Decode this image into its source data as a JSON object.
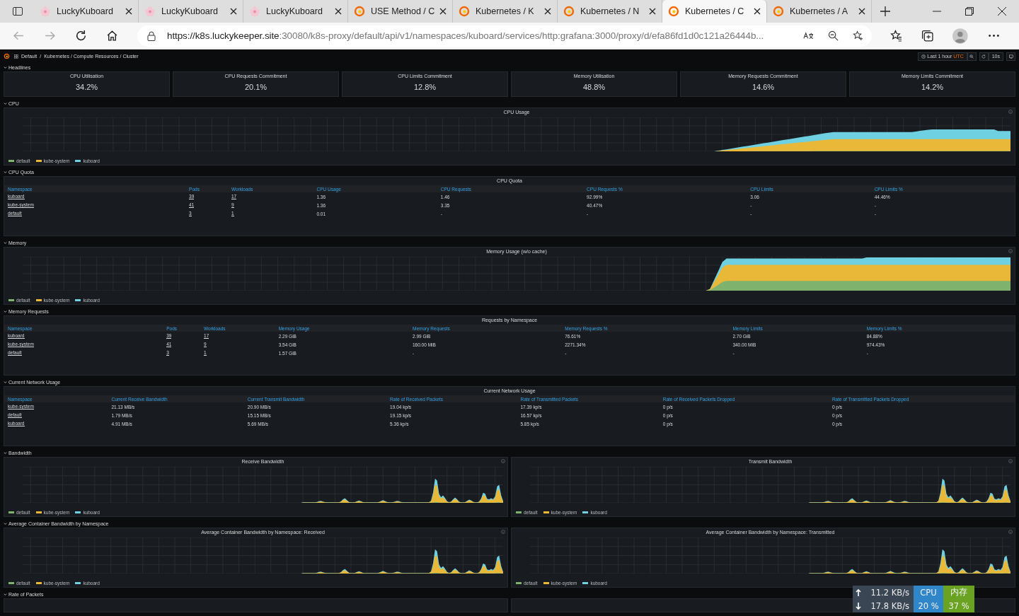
{
  "browser": {
    "tabs": [
      {
        "title": "LuckyKuboard",
        "selected": false
      },
      {
        "title": "LuckyKuboard",
        "selected": false
      },
      {
        "title": "LuckyKuboard",
        "selected": false
      },
      {
        "title": "USE Method / C",
        "selected": false
      },
      {
        "title": "Kubernetes / K",
        "selected": false
      },
      {
        "title": "Kubernetes / N",
        "selected": false
      },
      {
        "title": "Kubernetes / C",
        "selected": true
      },
      {
        "title": "Kubernetes / A",
        "selected": false
      }
    ],
    "url_host": "https://k8s.luckykeeper.site",
    "url_path": ":30080/k8s-proxy/default/api/v1/namespaces/kuboard/services/http:grafana:3000/proxy/d/efa86fd1d0c121a26444b..."
  },
  "dashboard": {
    "folder": "Default",
    "separator": "/",
    "title": "Kubernetes / Compute Resources / Cluster",
    "time_range": "Last 1 hour",
    "timezone": "UTC",
    "refresh": "10s"
  },
  "rows": [
    {
      "kind": "stats",
      "title": "Headlines",
      "stats": [
        {
          "label": "CPU Utilisation",
          "value": "34.2%"
        },
        {
          "label": "CPU Requests Commitment",
          "value": "20.1%"
        },
        {
          "label": "CPU Limits Commitment",
          "value": "12.8%"
        },
        {
          "label": "Memory Utilisation",
          "value": "48.8%"
        },
        {
          "label": "Memory Requests Commitment",
          "value": "14.6%"
        },
        {
          "label": "Memory Limits Commitment",
          "value": "14.2%"
        }
      ]
    },
    {
      "kind": "charts",
      "title": "CPU",
      "panels": [
        {
          "title": "CPU Usage",
          "legend": [
            {
              "name": "default",
              "color": "#7eb26d"
            },
            {
              "name": "kube-system",
              "color": "#eab839"
            },
            {
              "name": "kuboard",
              "color": "#6ed0e0"
            }
          ]
        }
      ]
    },
    {
      "kind": "table",
      "title": "CPU Quota",
      "panel_title": "CPU Quota",
      "columns": [
        {
          "name": "Namespace",
          "linked": true
        },
        {
          "name": "Pods",
          "linked": true
        },
        {
          "name": "Workloads",
          "linked": true
        },
        {
          "name": "CPU Usage",
          "linked": false
        },
        {
          "name": "CPU Requests",
          "linked": false
        },
        {
          "name": "CPU Requests %",
          "linked": false
        },
        {
          "name": "CPU Limits",
          "linked": false
        },
        {
          "name": "CPU Limits %",
          "linked": false
        }
      ],
      "rows": [
        [
          "kuboard",
          "39",
          "17",
          "1.36",
          "1.46",
          "92.99%",
          "3.06",
          "44.46%"
        ],
        [
          "kube-system",
          "41",
          "9",
          "1.36",
          "3.35",
          "40.47%",
          "-",
          "-"
        ],
        [
          "default",
          "3",
          "1",
          "0.01",
          "-",
          "-",
          "-",
          "-"
        ]
      ]
    },
    {
      "kind": "charts",
      "title": "Memory",
      "panels": [
        {
          "title": "Memory Usage (w/o cache)",
          "legend": [
            {
              "name": "default",
              "color": "#7eb26d"
            },
            {
              "name": "kube-system",
              "color": "#eab839"
            },
            {
              "name": "kuboard",
              "color": "#6ed0e0"
            }
          ]
        }
      ]
    },
    {
      "kind": "table",
      "title": "Memory Requests",
      "panel_title": "Requests by Namespace",
      "columns": [
        {
          "name": "Namespace",
          "linked": true
        },
        {
          "name": "Pods",
          "linked": true
        },
        {
          "name": "Workloads",
          "linked": true
        },
        {
          "name": "Memory Usage",
          "linked": false
        },
        {
          "name": "Memory Requests",
          "linked": false
        },
        {
          "name": "Memory Requests %",
          "linked": false
        },
        {
          "name": "Memory Limits",
          "linked": false
        },
        {
          "name": "Memory Limits %",
          "linked": false
        }
      ],
      "rows": [
        [
          "kuboard",
          "39",
          "17",
          "2.29 GiB",
          "2.99 GiB",
          "76.61%",
          "2.70 GiB",
          "84.88%"
        ],
        [
          "kube-system",
          "41",
          "9",
          "3.54 GiB",
          "160.00 MiB",
          "2271.34%",
          "340.00 MiB",
          "974.43%"
        ],
        [
          "default",
          "3",
          "1",
          "1.57 GiB",
          "-",
          "-",
          "-",
          "-"
        ]
      ]
    },
    {
      "kind": "table",
      "title": "Current Network Usage",
      "panel_title": "Current Network Usage",
      "columns": [
        {
          "name": "Namespace",
          "linked": true
        },
        {
          "name": "Current Receive Bandwidth",
          "linked": false
        },
        {
          "name": "Current Transmit Bandwidth",
          "linked": false
        },
        {
          "name": "Rate of Received Packets",
          "linked": false
        },
        {
          "name": "Rate of Transmitted Packets",
          "linked": false
        },
        {
          "name": "Rate of Received Packets Dropped",
          "linked": false
        },
        {
          "name": "Rate of Transmitted Packets Dropped",
          "linked": false
        }
      ],
      "rows": [
        [
          "kube-system",
          "21.13 MB/s",
          "20.90 MB/s",
          "19.04 kp/s",
          "17.39 kp/s",
          "0 p/s",
          "0 p/s"
        ],
        [
          "default",
          "1.79 MB/s",
          "15.15 MB/s",
          "19.15 kp/s",
          "16.57 kp/s",
          "0 p/s",
          "0 p/s"
        ],
        [
          "kuboard",
          "4.91 MB/s",
          "5.69 MB/s",
          "5.36 kp/s",
          "5.85 kp/s",
          "0 p/s",
          "0 p/s"
        ]
      ]
    },
    {
      "kind": "charts",
      "title": "Bandwidth",
      "panels": [
        {
          "title": "Receive Bandwidth",
          "legend": [
            {
              "name": "default",
              "color": "#7eb26d"
            },
            {
              "name": "kube-system",
              "color": "#eab839"
            },
            {
              "name": "kuboard",
              "color": "#6ed0e0"
            }
          ]
        },
        {
          "title": "Transmit Bandwidth",
          "legend": [
            {
              "name": "default",
              "color": "#7eb26d"
            },
            {
              "name": "kube-system",
              "color": "#eab839"
            },
            {
              "name": "kuboard",
              "color": "#6ed0e0"
            }
          ]
        }
      ]
    },
    {
      "kind": "charts",
      "title": "Average Container Bandwidth by Namespace",
      "panels": [
        {
          "title": "Average Container Bandwidth by Namespace: Received",
          "legend": [
            {
              "name": "default",
              "color": "#7eb26d"
            },
            {
              "name": "kube-system",
              "color": "#eab839"
            },
            {
              "name": "kuboard",
              "color": "#6ed0e0"
            }
          ]
        },
        {
          "title": "Average Container Bandwidth by Namespace: Transmitted",
          "legend": [
            {
              "name": "default",
              "color": "#7eb26d"
            },
            {
              "name": "kube-system",
              "color": "#eab839"
            },
            {
              "name": "kuboard",
              "color": "#6ed0e0"
            }
          ]
        }
      ]
    },
    {
      "kind": "cut",
      "title": "Rate of Packets"
    }
  ],
  "net_monitor": {
    "upload": "11.2 KB/s",
    "download": "17.8 KB/s",
    "cpu_label": "CPU",
    "cpu": "20 %",
    "mem_label": "内存",
    "mem": "37 %"
  }
}
